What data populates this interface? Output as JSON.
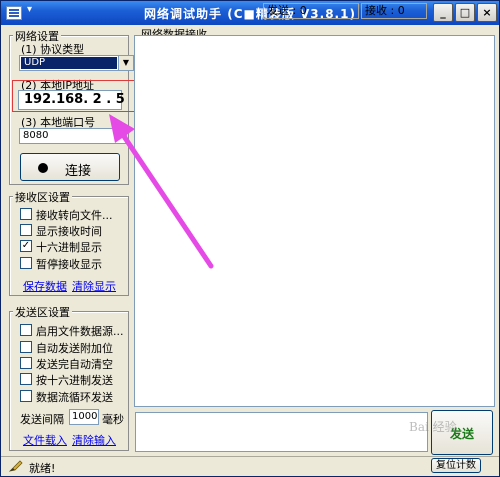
{
  "window": {
    "title": "网络调试助手 (C■精装版 V3.8.1)",
    "system_menu_glyph": "▾",
    "controls": {
      "minimize": "_",
      "maximize": "□",
      "close": "×"
    }
  },
  "network_settings": {
    "group_title": "网络设置",
    "protocol_label": "(1) 协议类型",
    "protocol_value": "UDP",
    "local_ip_label": "(2) 本地IP地址",
    "local_ip_value": "192.168. 2 . 5",
    "local_port_label": "(3) 本地端口号",
    "local_port_value": "8080",
    "connect_button": "连接"
  },
  "receive_settings": {
    "group_title": "接收区设置",
    "options": [
      {
        "label": "接收转向文件...",
        "checked": false,
        "mark": ""
      },
      {
        "label": "显示接收时间",
        "checked": false,
        "mark": ""
      },
      {
        "label": "十六进制显示",
        "checked": true,
        "mark": "✓"
      },
      {
        "label": "暂停接收显示",
        "checked": false,
        "mark": ""
      }
    ],
    "save_link": "保存数据",
    "clear_link": "清除显示"
  },
  "send_settings": {
    "group_title": "发送区设置",
    "options": [
      {
        "label": "启用文件数据源...",
        "checked": false,
        "mark": ""
      },
      {
        "label": "自动发送附加位",
        "checked": false,
        "mark": ""
      },
      {
        "label": "发送完自动清空",
        "checked": false,
        "mark": ""
      },
      {
        "label": "按十六进制发送",
        "checked": false,
        "mark": ""
      },
      {
        "label": "数据流循环发送",
        "checked": false,
        "mark": ""
      }
    ],
    "interval_label": "发送间隔",
    "interval_value": "1000",
    "interval_unit": "毫秒",
    "load_file_link": "文件载入",
    "clear_input_link": "清除输入"
  },
  "receive_area": {
    "title": "网络数据接收"
  },
  "send_button": "发送",
  "status_bar": {
    "status_text": "就绪!",
    "send_count": "发送 : 0",
    "recv_count": "接收 : 0",
    "reset_button": "复位计数"
  },
  "watermark": "Bai 经验",
  "colors": {
    "titlebar": "#0d47c0",
    "highlight_box": "#e03a3a",
    "arrow": "#e64ae6",
    "link": "#0000ee",
    "send_button_text": "#1a7a1a"
  }
}
